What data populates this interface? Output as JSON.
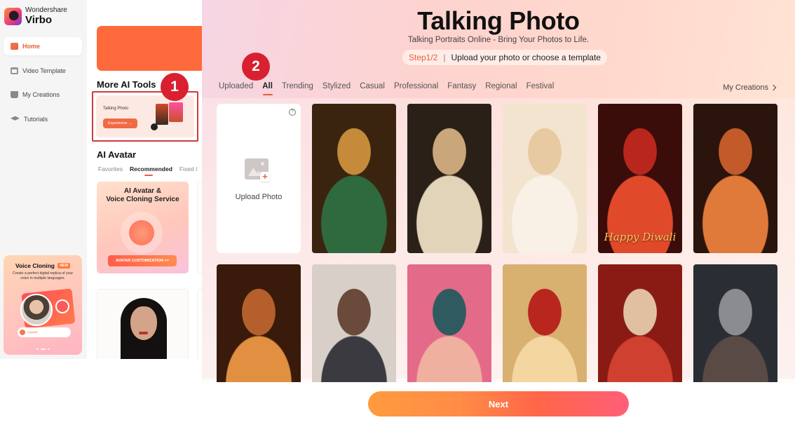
{
  "app": {
    "brand_top": "Wondershare",
    "brand_name": "Virbo"
  },
  "sidebar": {
    "items": [
      {
        "label": "Home",
        "icon": "home-icon",
        "active": true
      },
      {
        "label": "Video Template",
        "icon": "video-template-icon",
        "active": false
      },
      {
        "label": "My Creations",
        "icon": "my-creations-icon",
        "active": false
      },
      {
        "label": "Tutorials",
        "icon": "tutorials-icon",
        "active": false
      }
    ],
    "promo": {
      "title": "Voice Cloning",
      "badge": "NEW",
      "description": "Create a perfect digital replica of your voice in multiple languages.",
      "wave_label": "Clone01"
    }
  },
  "home": {
    "more_tools_title": "More AI Tools",
    "tool_card": {
      "title": "Talking Photo",
      "button": "Experience →"
    },
    "avatar_title": "AI Avatar",
    "avatar_tabs": [
      "Favorites",
      "Recommended",
      "Fixed I"
    ],
    "avatar_tabs_active": 1,
    "service_card": {
      "title_line1": "AI Avatar &",
      "title_line2": "Voice Cloning Service",
      "button": "AVATAR CUSTOMIZATION >>"
    }
  },
  "annotations": {
    "badge_1": "1",
    "badge_2": "2",
    "badge_color": "#d92030"
  },
  "talking_photo": {
    "title": "Talking Photo",
    "subtitle": "Talking Portraits Online - Bring Your Photos to Life.",
    "step": {
      "number": "Step1/2",
      "separator": "|",
      "text": "Upload your photo or choose a template"
    },
    "tabs": [
      "Uploaded",
      "All",
      "Trending",
      "Stylized",
      "Casual",
      "Professional",
      "Fantasy",
      "Regional",
      "Festival"
    ],
    "active_tab": "All",
    "my_creations_label": "My Creations",
    "upload": {
      "label": "Upload Photo",
      "help": "?"
    },
    "templates": [
      {
        "name": "template-woman-green-saree-diya",
        "colors": [
          "#3a2410",
          "#c58a3a",
          "#2f6a3e"
        ]
      },
      {
        "name": "template-woman-cream-saree",
        "colors": [
          "#2a2018",
          "#c9a77a",
          "#e2d4b8"
        ]
      },
      {
        "name": "template-girl-rabbit-moon",
        "colors": [
          "#f3e4cf",
          "#e7c9a2",
          "#f9f1e6"
        ]
      },
      {
        "name": "template-woman-red-saree-happy-diwali",
        "colors": [
          "#3a0c0a",
          "#b8261d",
          "#e04a2a"
        ],
        "caption": "Happy Diwali"
      },
      {
        "name": "template-woman-orange-saree-diya",
        "colors": [
          "#2a140c",
          "#c25a2a",
          "#e07a3a"
        ]
      },
      {
        "name": "template-woman-bokeh-saree",
        "colors": [
          "#3a1a0a",
          "#b5602c",
          "#e09040"
        ]
      },
      {
        "name": "template-cartoon-boy",
        "colors": [
          "#d8d0c8",
          "#6a4a3a",
          "#3a3a40"
        ]
      },
      {
        "name": "template-woman-pink-balloons",
        "colors": [
          "#e46a8a",
          "#2f5a60",
          "#f0b0a0"
        ]
      },
      {
        "name": "template-girl-red-scarf",
        "colors": [
          "#d8b070",
          "#b8261d",
          "#f4d6a0"
        ]
      },
      {
        "name": "template-woman-red-dragon",
        "colors": [
          "#8a1a14",
          "#e0c0a0",
          "#d04030"
        ]
      },
      {
        "name": "template-woman-silver-hair",
        "colors": [
          "#2a2e34",
          "#8a8c90",
          "#5a4a46"
        ]
      }
    ],
    "next_button": "Next"
  }
}
